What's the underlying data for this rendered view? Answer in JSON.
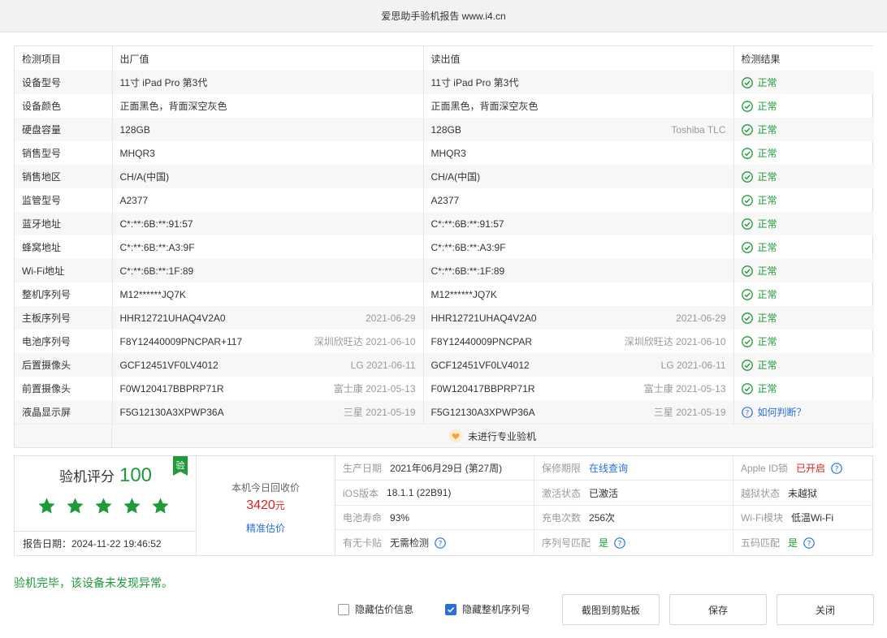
{
  "window": {
    "title": "爱思助手验机报告 www.i4.cn"
  },
  "table": {
    "headers": [
      "检测项目",
      "出厂值",
      "读出值",
      "检测结果"
    ],
    "rows": [
      {
        "item": "设备型号",
        "factory": "11寸 iPad Pro 第3代",
        "factory_meta": "",
        "read": "11寸 iPad Pro 第3代",
        "read_meta": "",
        "result": "正常",
        "status": "ok"
      },
      {
        "item": "设备颜色",
        "factory": "正面黑色，背面深空灰色",
        "factory_meta": "",
        "read": "正面黑色，背面深空灰色",
        "read_meta": "",
        "result": "正常",
        "status": "ok"
      },
      {
        "item": "硬盘容量",
        "factory": "128GB",
        "factory_meta": "",
        "read": "128GB",
        "read_meta": "Toshiba TLC",
        "result": "正常",
        "status": "ok"
      },
      {
        "item": "销售型号",
        "factory": "MHQR3",
        "factory_meta": "",
        "read": "MHQR3",
        "read_meta": "",
        "result": "正常",
        "status": "ok"
      },
      {
        "item": "销售地区",
        "factory": "CH/A(中国)",
        "factory_meta": "",
        "read": "CH/A(中国)",
        "read_meta": "",
        "result": "正常",
        "status": "ok"
      },
      {
        "item": "监管型号",
        "factory": "A2377",
        "factory_meta": "",
        "read": "A2377",
        "read_meta": "",
        "result": "正常",
        "status": "ok"
      },
      {
        "item": "蓝牙地址",
        "factory": "C*:**:6B:**:91:57",
        "factory_meta": "",
        "read": "C*:**:6B:**:91:57",
        "read_meta": "",
        "result": "正常",
        "status": "ok"
      },
      {
        "item": "蜂窝地址",
        "factory": "C*:**:6B:**:A3:9F",
        "factory_meta": "",
        "read": "C*:**:6B:**:A3:9F",
        "read_meta": "",
        "result": "正常",
        "status": "ok"
      },
      {
        "item": "Wi-Fi地址",
        "factory": "C*:**:6B:**:1F:89",
        "factory_meta": "",
        "read": "C*:**:6B:**:1F:89",
        "read_meta": "",
        "result": "正常",
        "status": "ok"
      },
      {
        "item": "整机序列号",
        "factory": "M12******JQ7K",
        "factory_meta": "",
        "read": "M12******JQ7K",
        "read_meta": "",
        "result": "正常",
        "status": "ok"
      },
      {
        "item": "主板序列号",
        "factory": "HHR12721UHAQ4V2A0",
        "factory_meta": "2021-06-29",
        "read": "HHR12721UHAQ4V2A0",
        "read_meta": "2021-06-29",
        "result": "正常",
        "status": "ok"
      },
      {
        "item": "电池序列号",
        "factory": "F8Y12440009PNCPAR+117",
        "factory_meta": "深圳欣旺达 2021-06-10",
        "read": "F8Y12440009PNCPAR",
        "read_meta": "深圳欣旺达 2021-06-10",
        "result": "正常",
        "status": "ok"
      },
      {
        "item": "后置摄像头",
        "factory": "GCF12451VF0LV4012",
        "factory_meta": "LG 2021-06-11",
        "read": "GCF12451VF0LV4012",
        "read_meta": "LG 2021-06-11",
        "result": "正常",
        "status": "ok"
      },
      {
        "item": "前置摄像头",
        "factory": "F0W120417BBPRP71R",
        "factory_meta": "富士康 2021-05-13",
        "read": "F0W120417BBPRP71R",
        "read_meta": "富士康 2021-05-13",
        "result": "正常",
        "status": "ok"
      },
      {
        "item": "液晶显示屏",
        "factory": "F5G12130A3XPWP36A",
        "factory_meta": "三星 2021-05-19",
        "read": "F5G12130A3XPWP36A",
        "read_meta": "三星 2021-05-19",
        "result": "如何判断？",
        "status": "help"
      }
    ],
    "footer_msg": "未进行专业验机"
  },
  "score": {
    "label": "验机评分",
    "value": "100",
    "badge": "验",
    "stars": 5,
    "report_date": "报告日期：2024-11-22 19:46:52"
  },
  "price": {
    "label": "本机今日回收价",
    "value": "3420",
    "unit": "元",
    "link": "精准估价"
  },
  "details": [
    {
      "label": "生产日期",
      "value": "2021年06月29日 (第27周)",
      "style": "",
      "help": false
    },
    {
      "label": "保修期限",
      "value": "在线查询",
      "style": "blue",
      "help": false
    },
    {
      "label": "Apple ID锁",
      "value": "已开启",
      "style": "red",
      "help": true
    },
    {
      "label": "iOS版本",
      "value": "18.1.1 (22B91)",
      "style": "",
      "help": false
    },
    {
      "label": "激活状态",
      "value": "已激活",
      "style": "",
      "help": false
    },
    {
      "label": "越狱状态",
      "value": "未越狱",
      "style": "",
      "help": false
    },
    {
      "label": "电池寿命",
      "value": "93%",
      "style": "",
      "help": false
    },
    {
      "label": "充电次数",
      "value": "256次",
      "style": "",
      "help": false
    },
    {
      "label": "Wi-Fi模块",
      "value": "低温Wi-Fi",
      "style": "",
      "help": false
    },
    {
      "label": "有无卡贴",
      "value": "无需检测",
      "style": "",
      "help": true
    },
    {
      "label": "序列号匹配",
      "value": "是",
      "style": "green",
      "help": true
    },
    {
      "label": "五码匹配",
      "value": "是",
      "style": "green",
      "help": true
    }
  ],
  "bottom": {
    "done_message": "验机完毕，该设备未发现异常。",
    "hide_price_label": "隐藏估价信息",
    "hide_price_checked": false,
    "hide_serial_label": "隐藏整机序列号",
    "hide_serial_checked": true,
    "copy_button": "截图到剪贴板",
    "save_button": "保存",
    "close_button": "关闭"
  },
  "colors": {
    "green": "#1e9a3a",
    "red": "#e0201f",
    "blue": "#2a6fd6"
  }
}
